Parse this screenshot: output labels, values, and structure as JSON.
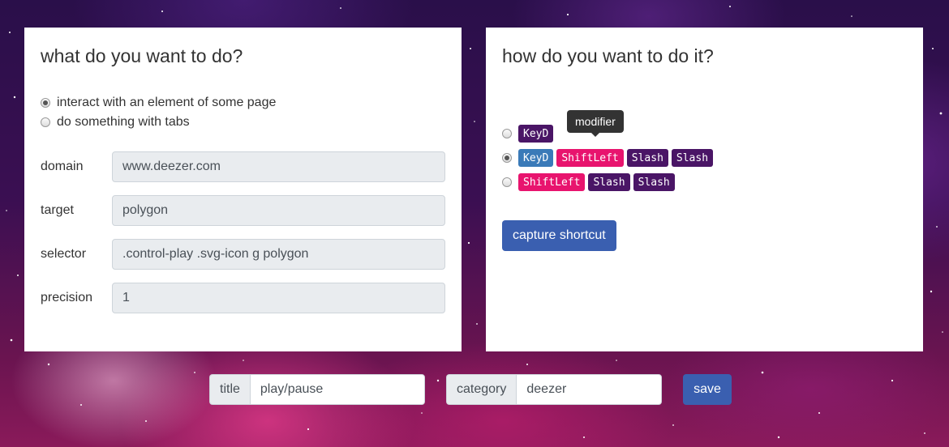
{
  "left_panel": {
    "heading": "what do you want to do?",
    "modes": [
      {
        "label": "interact with an element of some page",
        "checked": true
      },
      {
        "label": "do something with tabs",
        "checked": false
      }
    ],
    "fields": [
      {
        "label": "domain",
        "value": "www.deezer.com"
      },
      {
        "label": "target",
        "value": "polygon"
      },
      {
        "label": "selector",
        "value": ".control-play .svg-icon g polygon"
      },
      {
        "label": "precision",
        "value": "1"
      }
    ]
  },
  "right_panel": {
    "heading": "how do you want to do it?",
    "tooltip": "modifier",
    "combos": [
      {
        "checked": false,
        "keys": [
          {
            "text": "KeyD",
            "kind": "key"
          }
        ]
      },
      {
        "checked": true,
        "keys": [
          {
            "text": "KeyD",
            "kind": "key-blue"
          },
          {
            "text": "ShiftLeft",
            "kind": "mod"
          },
          {
            "text": "Slash",
            "kind": "key"
          },
          {
            "text": "Slash",
            "kind": "key"
          }
        ]
      },
      {
        "checked": false,
        "keys": [
          {
            "text": "ShiftLeft",
            "kind": "mod"
          },
          {
            "text": "Slash",
            "kind": "key"
          },
          {
            "text": "Slash",
            "kind": "key"
          }
        ]
      }
    ],
    "capture_label": "capture shortcut"
  },
  "bottom": {
    "title_label": "title",
    "title_value": "play/pause",
    "category_label": "category",
    "category_value": "deezer",
    "save_label": "save"
  },
  "colors": {
    "primary_button": "#3a5fb0",
    "key_badge": "#4a1566",
    "key_badge_active": "#3a7ab8",
    "modifier_badge": "#e8146e"
  }
}
